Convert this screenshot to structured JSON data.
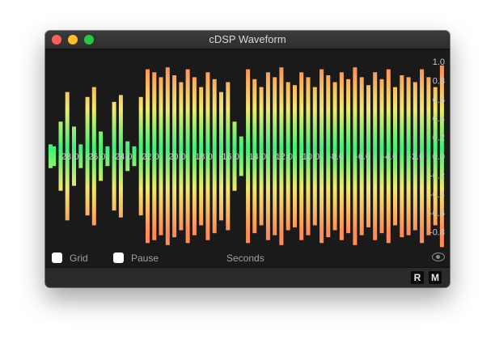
{
  "window": {
    "title": "cDSP Waveform"
  },
  "controls": {
    "grid_label": "Grid",
    "pause_label": "Pause",
    "x_axis_label": "Seconds"
  },
  "buttons": {
    "r_label": "R",
    "m_label": "M"
  },
  "colors": {
    "peak": "#ff8c5a",
    "mid": "#f2e96a",
    "center": "#3ef07a",
    "axis_text": "#c8c8c8"
  },
  "chart_data": {
    "type": "area",
    "xlabel": "Seconds",
    "ylabel": "",
    "xlim": [
      -29.5,
      0
    ],
    "ylim": [
      -1.0,
      1.0
    ],
    "x_ticks": [
      "-28.0",
      "-26.0",
      "-24.0",
      "-22.0",
      "-20.0",
      "-18.0",
      "-16.0",
      "-14.0",
      "-12.0",
      "-10.0",
      "-8.0",
      "-6.0",
      "-4.0",
      "-2.0"
    ],
    "y_ticks": [
      "1.0",
      "0.8",
      "0.6",
      "0.4",
      "0.2",
      "0.0",
      "-0.2",
      "-0.4",
      "-0.6",
      "-0.8",
      "-1.0"
    ],
    "grid": false,
    "series": [
      {
        "x": [
          -29.5,
          -29.0,
          -28.5,
          -28.0,
          -27.5,
          -27.0,
          -26.5,
          -26.0,
          -25.5,
          -25.0,
          -24.5,
          -24.0,
          -23.5,
          -23.0,
          -22.5,
          -22.0,
          -21.5,
          -21.0,
          -20.5,
          -20.0,
          -19.5,
          -19.0,
          -18.5,
          -18.0,
          -17.5,
          -17.0,
          -16.5,
          -16.0,
          -15.5,
          -15.0,
          -14.5,
          -14.0,
          -13.5,
          -13.0,
          -12.5,
          -12.0,
          -11.5,
          -11.0,
          -10.5,
          -10.0,
          -9.5,
          -9.0,
          -8.5,
          -8.0,
          -7.5,
          -7.0,
          -6.5,
          -6.0,
          -5.5,
          -5.0,
          -4.5,
          -4.0,
          -3.5,
          -3.0,
          -2.5,
          -2.0,
          -1.5,
          -1.0,
          -0.5,
          0.0
        ],
        "values": [
          0.12,
          0.1,
          0.35,
          0.65,
          0.3,
          0.12,
          0.6,
          0.7,
          0.25,
          0.1,
          0.55,
          0.62,
          0.15,
          0.1,
          0.6,
          0.88,
          0.85,
          0.8,
          0.9,
          0.82,
          0.75,
          0.88,
          0.8,
          0.7,
          0.85,
          0.78,
          0.65,
          0.75,
          0.35,
          0.2,
          0.88,
          0.78,
          0.7,
          0.85,
          0.8,
          0.9,
          0.75,
          0.72,
          0.85,
          0.8,
          0.7,
          0.88,
          0.82,
          0.75,
          0.85,
          0.78,
          0.9,
          0.8,
          0.72,
          0.85,
          0.78,
          0.88,
          0.7,
          0.82,
          0.8,
          0.75,
          0.88,
          0.8,
          0.7,
          0.92
        ]
      }
    ]
  }
}
